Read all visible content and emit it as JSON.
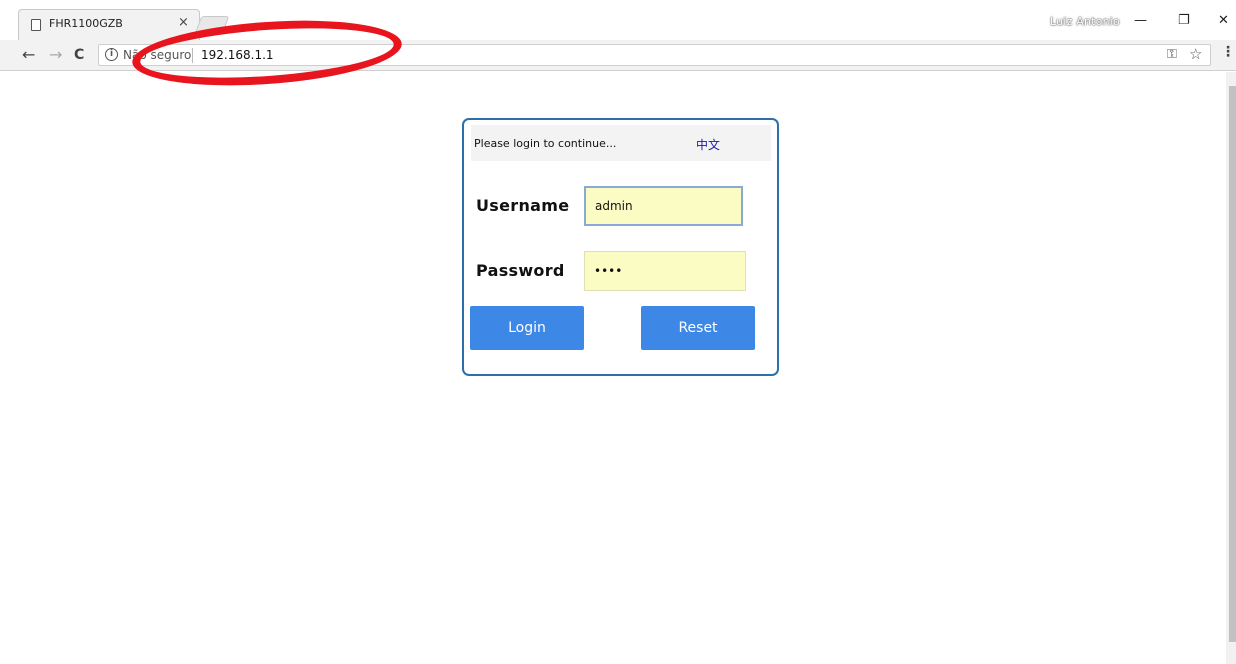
{
  "browser": {
    "tab_title": "FHR1100GZB",
    "tab_close": "×",
    "profile_name": "Luiz Antonio",
    "minimize": "—",
    "restore": "❐",
    "close": "✕",
    "back": "←",
    "forward": "→",
    "reload": "C",
    "info": "i",
    "security_text": "Não seguro",
    "url": "192.168.1.1",
    "key_icon": "⚿",
    "star_icon": "☆",
    "menu_icon": "⋮"
  },
  "login": {
    "prompt": "Please login to continue...",
    "language_link": "中文",
    "username_label": "Username",
    "username_value": "admin",
    "password_label": "Password",
    "password_value": "••••",
    "login_button": "Login",
    "reset_button": "Reset"
  },
  "colors": {
    "accent": "#3d87e6",
    "box_border": "#2d6fa7",
    "input_bg": "#fafcc4",
    "annotation": "#e8141e"
  }
}
